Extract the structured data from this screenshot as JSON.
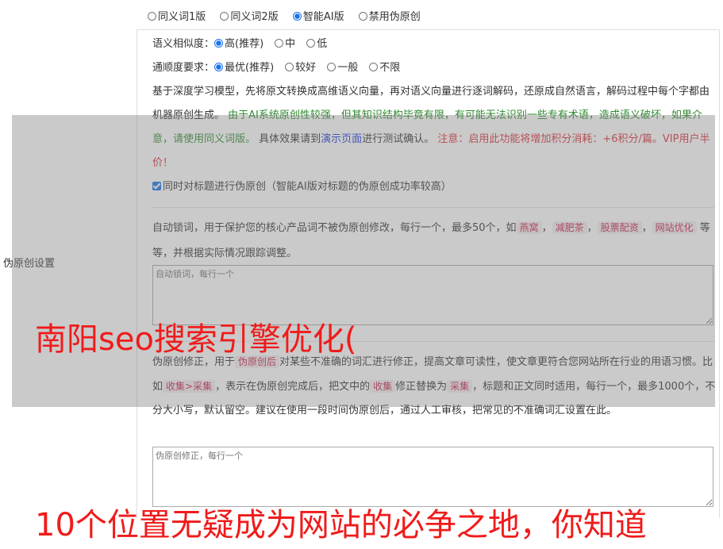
{
  "top_options": [
    {
      "label": "同义词1版",
      "checked": false
    },
    {
      "label": "同义词2版",
      "checked": false
    },
    {
      "label": "智能AI版",
      "checked": true
    },
    {
      "label": "禁用伪原创",
      "checked": false
    }
  ],
  "side_label": "伪原创设置",
  "similarity": {
    "label": "语义相似度：",
    "options": [
      {
        "label": "高(推荐)",
        "checked": true
      },
      {
        "label": "中",
        "checked": false
      },
      {
        "label": "低",
        "checked": false
      }
    ]
  },
  "fluency": {
    "label": "通顺度要求：",
    "options": [
      {
        "label": "最优(推荐)",
        "checked": true
      },
      {
        "label": "较好",
        "checked": false
      },
      {
        "label": "一般",
        "checked": false
      },
      {
        "label": "不限",
        "checked": false
      }
    ]
  },
  "ai_desc": {
    "part1": "基于深度学习模型，先将原文转换成高维语义向量，再对语义向量进行逐词解码，还原成自然语言，解码过程中每个字都由机器原创生成。",
    "part2": "由于AI系统原创性较强，但其知识结构毕竟有限，有可能无法识别一些专有术语，造成语义破坏，如果介意，请使用同义词版。",
    "part3": "具体效果请到",
    "link": "演示页面",
    "part4": "进行测试确认。",
    "part5": "注意：启用此功能将增加积分消耗：+6积分/篇。VIP用户半价！"
  },
  "title_check": {
    "label": "同时对标题进行伪原创（智能AI版对标题的伪原创成功率较高）",
    "checked": true
  },
  "lock": {
    "text1": "自动锁词，用于保护您的核心产品词不被伪原创修改，每行一个，最多50个，如",
    "tags": [
      "燕窝",
      "减肥茶",
      "股票配资",
      "网站优化"
    ],
    "sep": "，",
    "text2": "等等，并根据实际情况跟踪调整。",
    "placeholder": "自动锁词，每行一个"
  },
  "correct": {
    "text1": "伪原创修正，用于",
    "tag1": "伪原创后",
    "text2": "对某些不准确的词汇进行修正，提高文章可读性，使文章更符合您网站所在行业的用语习惯。比如",
    "tag2": "收集>采集",
    "text3": "，表示在伪原创完成后，把文中的",
    "tag3": "收集",
    "text4": "修正替换为",
    "tag4": "采集",
    "text5": "，标题和正文同时适用，每行一个，最多1000个，不分大小写，默认留空。建议在使用一段时间伪原创后，通过人工审核，把常见的不准确词汇设置在此。",
    "placeholder": "伪原创修正，每行一个"
  },
  "headline": "南阳seo搜索引擎优化(",
  "headline2": "10个位置无疑成为网站的必争之地，你知道"
}
